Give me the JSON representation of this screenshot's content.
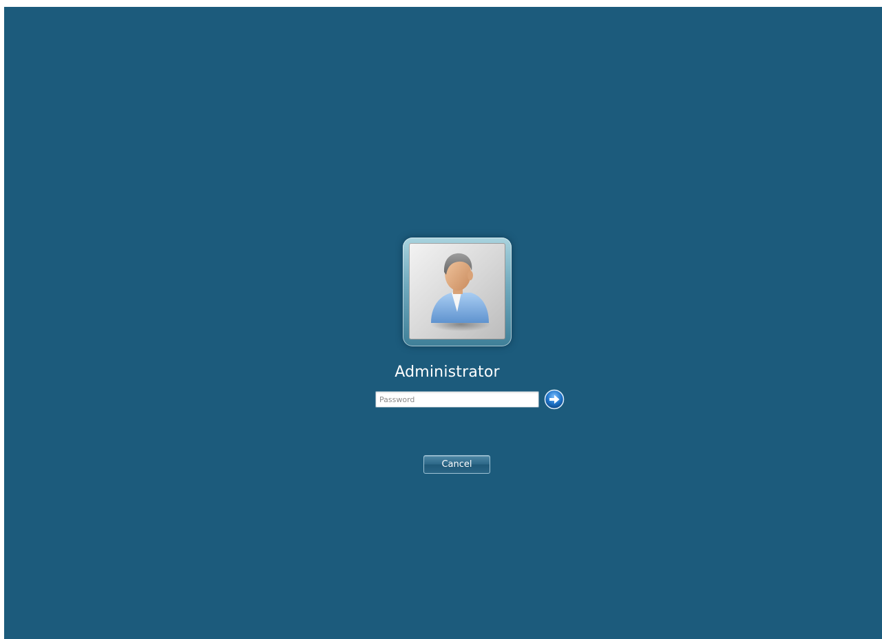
{
  "user": {
    "name": "Administrator"
  },
  "password": {
    "placeholder": "Password",
    "value": ""
  },
  "submit": {
    "icon": "arrow-right-icon"
  },
  "cancel": {
    "label": "Cancel"
  },
  "colors": {
    "background": "#1c5b7c",
    "text": "#ffffff",
    "arrow_circle": "#1e73c8"
  }
}
